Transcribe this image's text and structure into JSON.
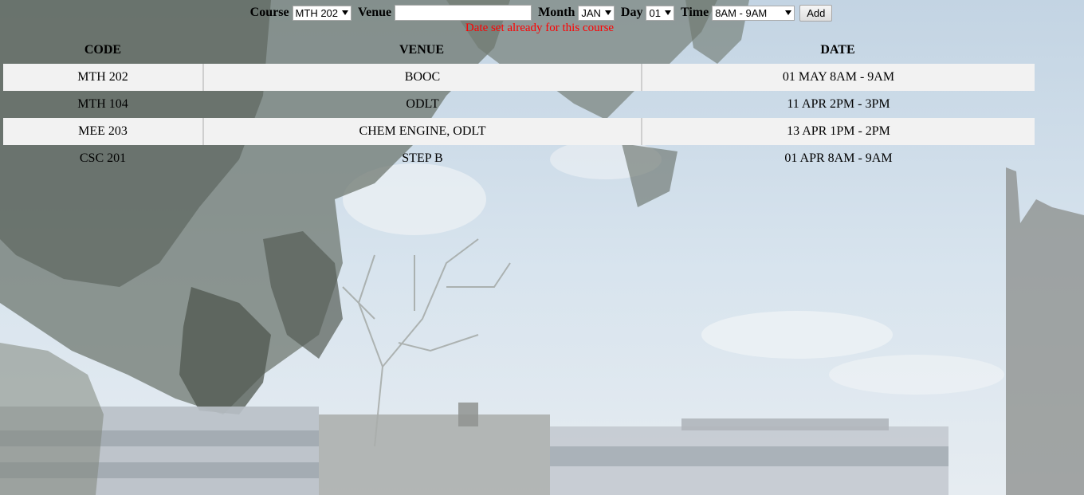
{
  "form": {
    "course_label": "Course",
    "course_value": "MTH 202",
    "venue_label": "Venue",
    "venue_value": "",
    "month_label": "Month",
    "month_value": "JAN",
    "day_label": "Day",
    "day_value": "01",
    "time_label": "Time",
    "time_value": "8AM - 9AM",
    "add_label": "Add"
  },
  "error_message": "Date set already for this course",
  "error_color": "#ff0000",
  "table": {
    "headers": [
      "CODE",
      "VENUE",
      "DATE"
    ],
    "rows": [
      {
        "code": "MTH 202",
        "venue": "BOOC",
        "date": "01 MAY 8AM - 9AM"
      },
      {
        "code": "MTH 104",
        "venue": "ODLT",
        "date": "11 APR 2PM - 3PM"
      },
      {
        "code": "MEE 203",
        "venue": "CHEM ENGINE, ODLT",
        "date": "13 APR 1PM - 2PM"
      },
      {
        "code": "CSC 201",
        "venue": "STEP B",
        "date": "01 APR 8AM - 9AM"
      }
    ]
  }
}
